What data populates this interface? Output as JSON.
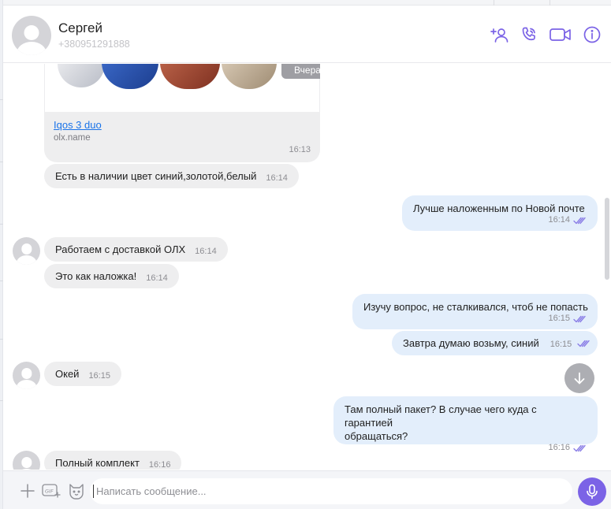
{
  "contact": {
    "name": "Сергей",
    "phone": "+380951291888",
    "avatar_icon": "user-avatar-icon"
  },
  "header_actions": [
    {
      "icon": "add-contact-icon"
    },
    {
      "icon": "call-icon"
    },
    {
      "icon": "video-call-icon"
    },
    {
      "icon": "info-icon"
    }
  ],
  "link_card": {
    "date_label": "Вчера",
    "title": "Iqos 3 duo",
    "host": "olx.name",
    "time": "16:13"
  },
  "messages": [
    {
      "dir": "in",
      "text": "Есть в наличии цвет синий,золотой,белый",
      "time": "16:14"
    },
    {
      "dir": "out",
      "text": "Лучше наложенным по Новой почте",
      "time": "16:14"
    },
    {
      "dir": "in",
      "text": "Работаем с доставкой ОЛХ",
      "time": "16:14"
    },
    {
      "dir": "in",
      "text": "Это как наложка!",
      "time": "16:14"
    },
    {
      "dir": "out",
      "text": "Изучу вопрос, не сталкивался, чтоб не попасть",
      "time": "16:15"
    },
    {
      "dir": "out",
      "text": "Завтра думаю возьму, синий",
      "time": "16:15"
    },
    {
      "dir": "in",
      "text": "Окей",
      "time": "16:15"
    },
    {
      "dir": "out",
      "text": "Там полный пакет? В случае чего куда с гарантией",
      "text2": "обращаться?",
      "time": "16:16"
    },
    {
      "dir": "in",
      "text": "Полный комплект",
      "time": "16:16"
    }
  ],
  "composer": {
    "placeholder": "Написать сообщение...",
    "gif_label": "GIF"
  },
  "colors": {
    "accent": "#7b63e6",
    "incoming_bubble": "#eeeeef",
    "outgoing_bubble": "#e3eefb",
    "link": "#1a73e8",
    "read_checks": "#8a7ee6"
  }
}
